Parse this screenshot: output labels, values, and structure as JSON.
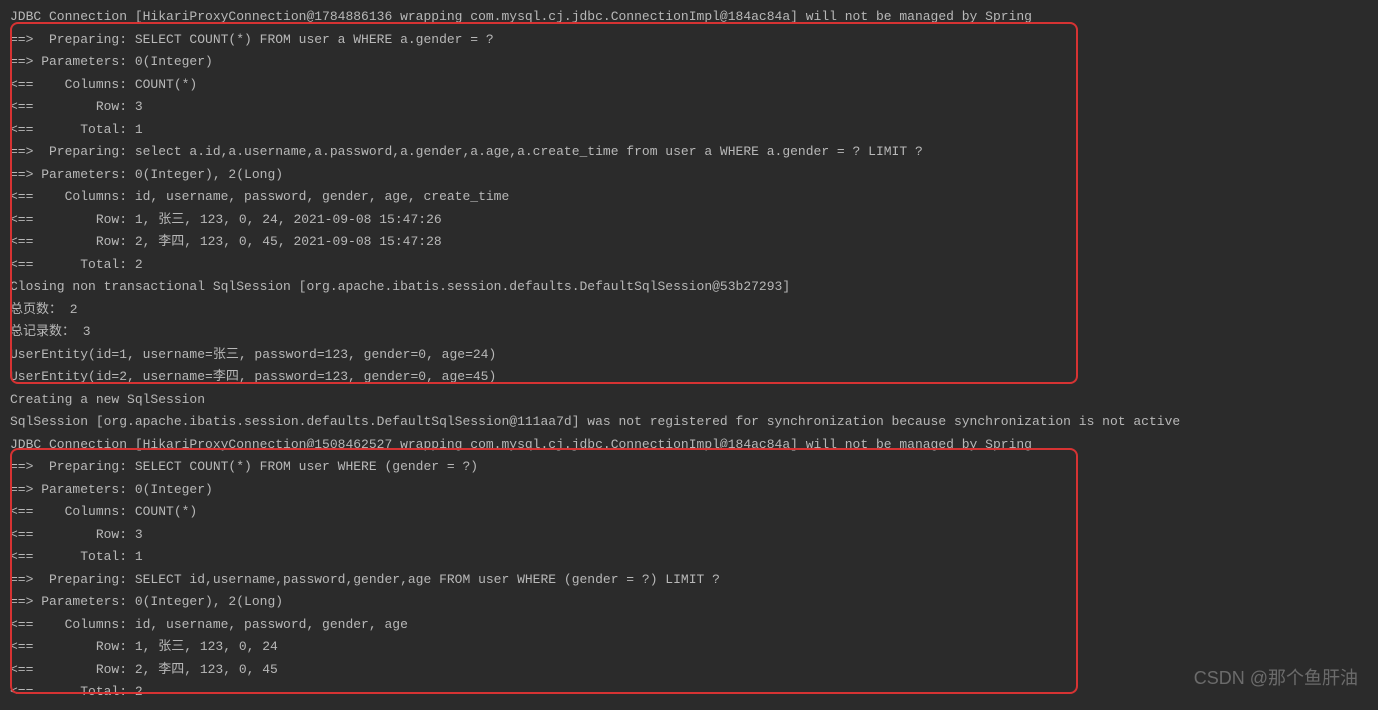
{
  "lines": [
    "JDBC Connection [HikariProxyConnection@1784886136 wrapping com.mysql.cj.jdbc.ConnectionImpl@184ac84a] will not be managed by Spring",
    "==>  Preparing: SELECT COUNT(*) FROM user a WHERE a.gender = ?",
    "==> Parameters: 0(Integer)",
    "<==    Columns: COUNT(*)",
    "<==        Row: 3",
    "<==      Total: 1",
    "==>  Preparing: select a.id,a.username,a.password,a.gender,a.age,a.create_time from user a WHERE a.gender = ? LIMIT ?",
    "==> Parameters: 0(Integer), 2(Long)",
    "<==    Columns: id, username, password, gender, age, create_time",
    "<==        Row: 1, 张三, 123, 0, 24, 2021-09-08 15:47:26",
    "<==        Row: 2, 李四, 123, 0, 45, 2021-09-08 15:47:28",
    "<==      Total: 2",
    "Closing non transactional SqlSession [org.apache.ibatis.session.defaults.DefaultSqlSession@53b27293]",
    "总页数： 2",
    "总记录数： 3",
    "UserEntity(id=1, username=张三, password=123, gender=0, age=24)",
    "UserEntity(id=2, username=李四, password=123, gender=0, age=45)",
    "Creating a new SqlSession",
    "SqlSession [org.apache.ibatis.session.defaults.DefaultSqlSession@111aa7d] was not registered for synchronization because synchronization is not active",
    "JDBC Connection [HikariProxyConnection@1508462527 wrapping com.mysql.cj.jdbc.ConnectionImpl@184ac84a] will not be managed by Spring",
    "==>  Preparing: SELECT COUNT(*) FROM user WHERE (gender = ?)",
    "==> Parameters: 0(Integer)",
    "<==    Columns: COUNT(*)",
    "<==        Row: 3",
    "<==      Total: 1",
    "==>  Preparing: SELECT id,username,password,gender,age FROM user WHERE (gender = ?) LIMIT ?",
    "==> Parameters: 0(Integer), 2(Long)",
    "<==    Columns: id, username, password, gender, age",
    "<==        Row: 1, 张三, 123, 0, 24",
    "<==        Row: 2, 李四, 123, 0, 45",
    "<==      Total: 2"
  ],
  "watermark": "CSDN @那个鱼肝油"
}
